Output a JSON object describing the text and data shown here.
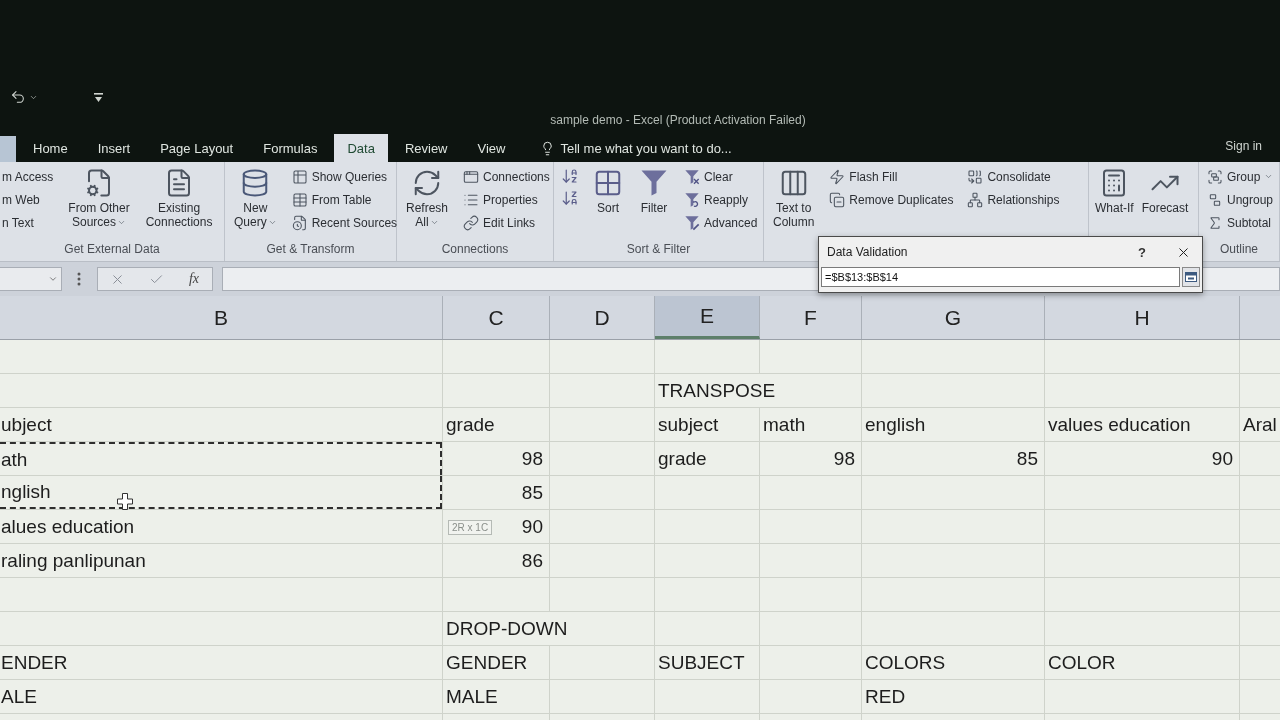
{
  "window": {
    "title": "sample demo - Excel (Product Activation Failed)",
    "sign_in": "Sign in"
  },
  "tabs": [
    {
      "label": "Home",
      "selected": false
    },
    {
      "label": "Insert",
      "selected": false
    },
    {
      "label": "Page Layout",
      "selected": false
    },
    {
      "label": "Formulas",
      "selected": false
    },
    {
      "label": "Data",
      "selected": true
    },
    {
      "label": "Review",
      "selected": false
    },
    {
      "label": "View",
      "selected": false
    }
  ],
  "tell_me": {
    "placeholder": "Tell me what you want to do..."
  },
  "ribbon": {
    "groups": [
      {
        "label": "Get External Data",
        "items": [
          {
            "kind": "stack",
            "buttons": [
              {
                "label": "m Access"
              },
              {
                "label": "m Web"
              },
              {
                "label": "n Text"
              }
            ]
          },
          {
            "kind": "large",
            "label": "From Other\nSources",
            "dropdown": true
          },
          {
            "kind": "large",
            "label": "Existing\nConnections",
            "dropdown": false
          }
        ]
      },
      {
        "label": "Get & Transform",
        "items": [
          {
            "kind": "large",
            "label": "New\nQuery",
            "dropdown": true
          },
          {
            "kind": "stack",
            "buttons": [
              {
                "label": "Show Queries"
              },
              {
                "label": "From Table"
              },
              {
                "label": "Recent Sources"
              }
            ]
          }
        ]
      },
      {
        "label": "Connections",
        "items": [
          {
            "kind": "large",
            "label": "Refresh\nAll",
            "dropdown": true
          },
          {
            "kind": "stack",
            "buttons": [
              {
                "label": "Connections"
              },
              {
                "label": "Properties"
              },
              {
                "label": "Edit Links"
              }
            ]
          }
        ]
      },
      {
        "label": "Sort & Filter",
        "items": [
          {
            "kind": "sort_pair"
          },
          {
            "kind": "large",
            "label": "Sort",
            "dropdown": false
          },
          {
            "kind": "large",
            "label": "Filter",
            "dropdown": false
          },
          {
            "kind": "stack",
            "buttons": [
              {
                "label": "Clear"
              },
              {
                "label": "Reapply"
              },
              {
                "label": "Advanced"
              }
            ]
          }
        ]
      },
      {
        "items": [
          {
            "kind": "large",
            "label": "Text to\nColumn",
            "dropdown": false
          },
          {
            "kind": "stack",
            "buttons": [
              {
                "label": "Flash Fill"
              },
              {
                "label": "Remove Duplicates"
              }
            ]
          },
          {
            "kind": "stack",
            "buttons": [
              {
                "label": "Consolidate"
              },
              {
                "label": "Relationships"
              }
            ]
          }
        ]
      },
      {
        "items": [
          {
            "kind": "large",
            "label": "What-If",
            "dropdown": false
          },
          {
            "kind": "large",
            "label": "Forecast",
            "dropdown": false
          }
        ]
      },
      {
        "label": "Outline",
        "items": [
          {
            "kind": "stack",
            "buttons": [
              {
                "label": "Group",
                "dropdown": true
              },
              {
                "label": "Ungroup",
                "dropdown": false
              },
              {
                "label": "Subtotal",
                "dropdown": false
              }
            ]
          }
        ]
      }
    ]
  },
  "formula_bar": {
    "function_button": "fx"
  },
  "dialog": {
    "title": "Data Validation",
    "help": "?",
    "value": "=$B$13:$B$14"
  },
  "sheet": {
    "columns": [
      {
        "label": "B",
        "selected": false
      },
      {
        "label": "C",
        "selected": false
      },
      {
        "label": "D",
        "selected": false
      },
      {
        "label": "E",
        "selected": true
      },
      {
        "label": "F",
        "selected": false
      },
      {
        "label": "G",
        "selected": false
      },
      {
        "label": "H",
        "selected": false
      }
    ],
    "rows": [
      {
        "cells": [
          null,
          null,
          null,
          null,
          null,
          null,
          null,
          null
        ]
      },
      {
        "cells": [
          null,
          null,
          null,
          {
            "kind": "text",
            "value": "TRANSPOSE",
            "marquee": false
          },
          null,
          null,
          null,
          null
        ]
      },
      {
        "cells": [
          {
            "kind": "text",
            "value": "ubject",
            "marquee": false
          },
          {
            "kind": "text",
            "value": "grade",
            "marquee": false
          },
          null,
          {
            "kind": "text",
            "value": "subject",
            "marquee": false
          },
          {
            "kind": "text",
            "value": "math",
            "marquee": false
          },
          {
            "kind": "text",
            "value": "english",
            "marquee": false
          },
          {
            "kind": "text",
            "value": "values education",
            "marquee": false
          },
          {
            "kind": "text",
            "value": "Aral",
            "marquee": false
          }
        ]
      },
      {
        "cells": [
          {
            "kind": "text",
            "value": "ath",
            "marquee": true
          },
          {
            "kind": "number",
            "value": "98",
            "marquee": false
          },
          null,
          {
            "kind": "text",
            "value": "grade",
            "marquee": false
          },
          {
            "kind": "number",
            "value": "98",
            "marquee": false
          },
          {
            "kind": "number",
            "value": "85",
            "marquee": false
          },
          {
            "kind": "number",
            "value": "90",
            "marquee": false
          },
          null
        ]
      },
      {
        "cells": [
          {
            "kind": "text",
            "value": "nglish",
            "marquee": true
          },
          {
            "kind": "number",
            "value": "85",
            "marquee": false
          },
          null,
          null,
          null,
          null,
          null,
          null
        ]
      },
      {
        "cells": [
          {
            "kind": "text",
            "value": "alues education",
            "marquee": false
          },
          {
            "kind": "number",
            "value": "90",
            "marquee": false,
            "tip": "2R x 1C"
          },
          null,
          null,
          null,
          null,
          null,
          null
        ]
      },
      {
        "cells": [
          {
            "kind": "text",
            "value": "raling panlipunan",
            "marquee": false
          },
          {
            "kind": "number",
            "value": "86",
            "marquee": false
          },
          null,
          null,
          null,
          null,
          null,
          null
        ]
      },
      {
        "cells": [
          null,
          null,
          null,
          null,
          null,
          null,
          null,
          null
        ]
      },
      {
        "cells": [
          null,
          {
            "kind": "text",
            "value": "DROP-DOWN",
            "marquee": false
          },
          null,
          null,
          null,
          null,
          null,
          null
        ]
      },
      {
        "cells": [
          {
            "kind": "text",
            "value": "ENDER",
            "marquee": false
          },
          {
            "kind": "text",
            "value": "GENDER",
            "marquee": false
          },
          null,
          {
            "kind": "text",
            "value": "SUBJECT",
            "marquee": false
          },
          null,
          {
            "kind": "text",
            "value": "COLORS",
            "marquee": false
          },
          {
            "kind": "text",
            "value": "COLOR",
            "marquee": false
          },
          null
        ]
      },
      {
        "cells": [
          {
            "kind": "text",
            "value": "ALE",
            "marquee": false
          },
          {
            "kind": "text",
            "value": "MALE",
            "marquee": false
          },
          null,
          null,
          null,
          {
            "kind": "text",
            "value": "RED",
            "marquee": false
          },
          null,
          null
        ]
      }
    ]
  }
}
